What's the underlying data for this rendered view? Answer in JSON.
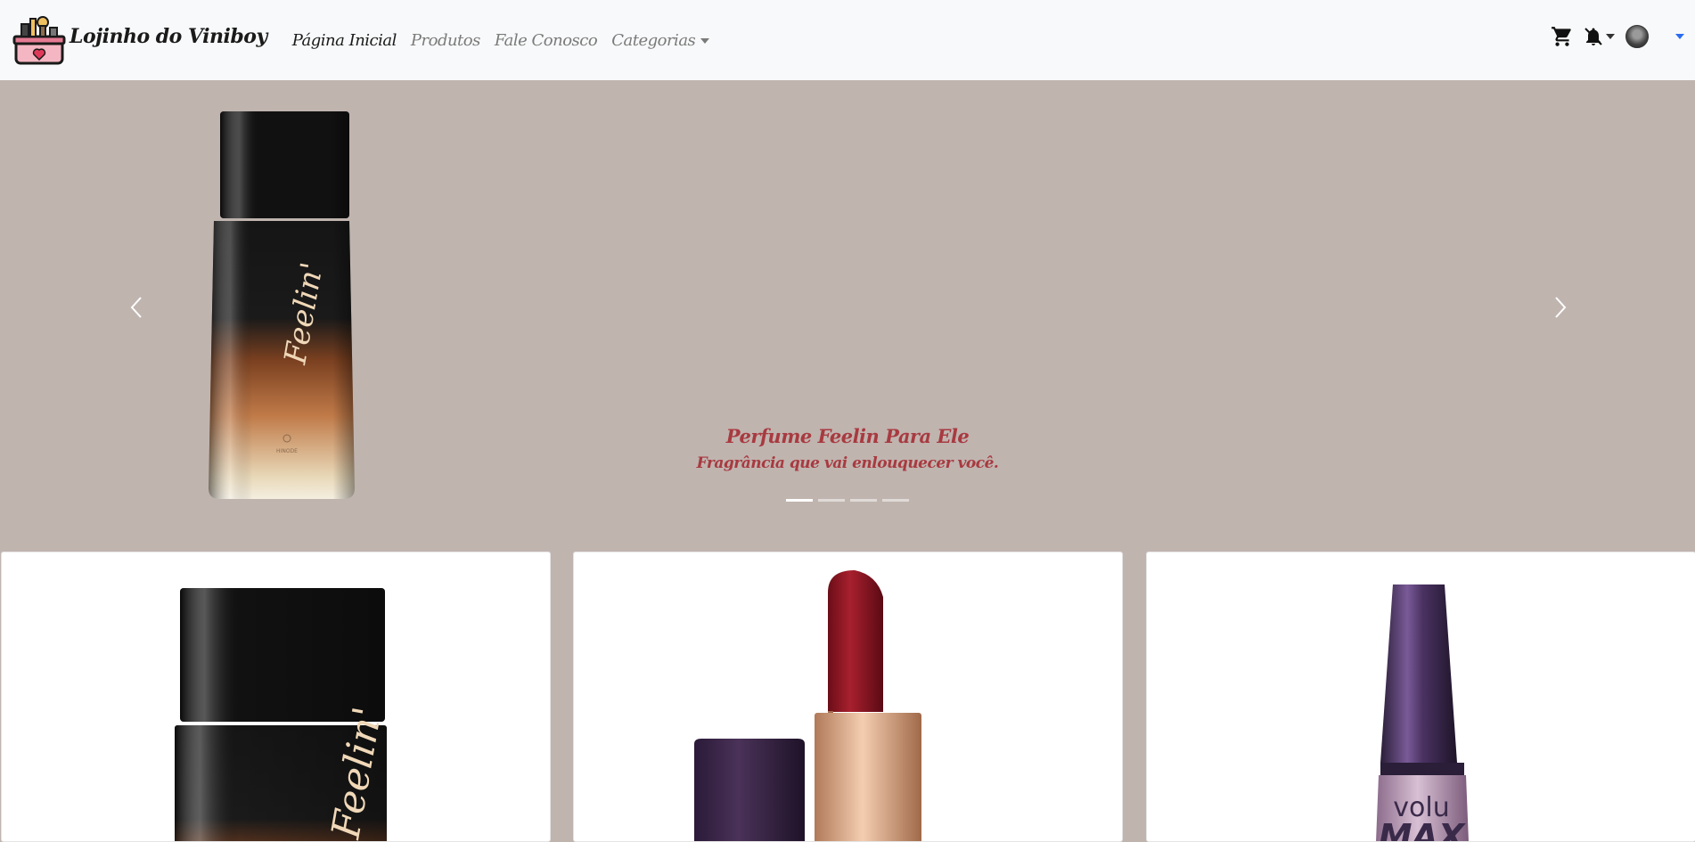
{
  "brand": {
    "name": "Lojinho do Viniboy",
    "logo_icon": "shop-logo-icon"
  },
  "nav": {
    "home": "Página Inicial",
    "products": "Produtos",
    "contact": "Fale Conosco",
    "categories": "Categorias"
  },
  "header_icons": {
    "cart": "cart-icon",
    "notifications": "bell-icon",
    "user": "avatar"
  },
  "carousel": {
    "slide_title": "Perfume Feelin Para Ele",
    "slide_subtitle": "Fragrância que vai enlouquecer você.",
    "bottle_label": "Feelin'",
    "bottle_brand": "HINODE",
    "indicators_count": 4,
    "active_index": 0
  },
  "cards": [
    {
      "product": "perfume-bottle",
      "label": "Feelin'"
    },
    {
      "product": "lipstick"
    },
    {
      "product": "mascara",
      "label": "volu MAX"
    }
  ],
  "colors": {
    "navbar_bg": "#f8f9fa",
    "carousel_bg": "#c0b4af",
    "caption": "#a83a40"
  }
}
